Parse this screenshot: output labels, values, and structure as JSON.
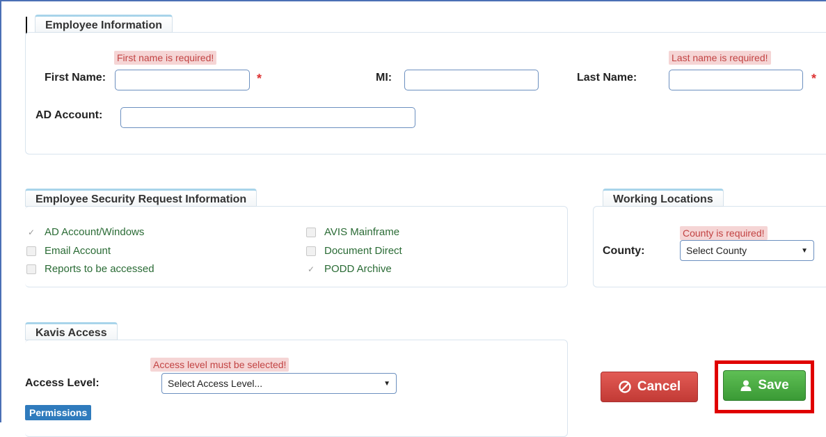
{
  "employee_info": {
    "legend": "Employee Information",
    "first_name_label": "First Name:",
    "first_name_value": "",
    "first_name_error": "First name is required!",
    "mi_label": "MI:",
    "mi_value": "",
    "last_name_label": "Last Name:",
    "last_name_value": "",
    "last_name_error": "Last name is required!",
    "ad_account_label": "AD Account:",
    "ad_account_value": "",
    "required_marker": "*"
  },
  "security_request": {
    "legend": "Employee Security Request Information",
    "options": [
      {
        "label": "AD Account/Windows",
        "checked": true
      },
      {
        "label": "Email Account",
        "checked": false
      },
      {
        "label": "Reports to be accessed",
        "checked": false
      },
      {
        "label": "AVIS Mainframe",
        "checked": false
      },
      {
        "label": "Document Direct",
        "checked": false
      },
      {
        "label": "PODD Archive",
        "checked": true
      }
    ],
    "check_glyph": "✓"
  },
  "working_locations": {
    "legend": "Working Locations",
    "county_label": "County:",
    "county_error": "County is required!",
    "county_selected": "Select County"
  },
  "kavis_access": {
    "legend": "Kavis Access",
    "access_level_label": "Access Level:",
    "access_level_error": "Access level must be selected!",
    "access_level_selected": "Select Access Level...",
    "permissions_label": "Permissions"
  },
  "actions": {
    "cancel_label": "Cancel",
    "save_label": "Save"
  },
  "colors": {
    "error_bg": "#f5d5d5",
    "checkbox_text": "#2a6b35",
    "cancel": "#c23a35",
    "save": "#3a9a35",
    "highlight": "#e00000"
  }
}
